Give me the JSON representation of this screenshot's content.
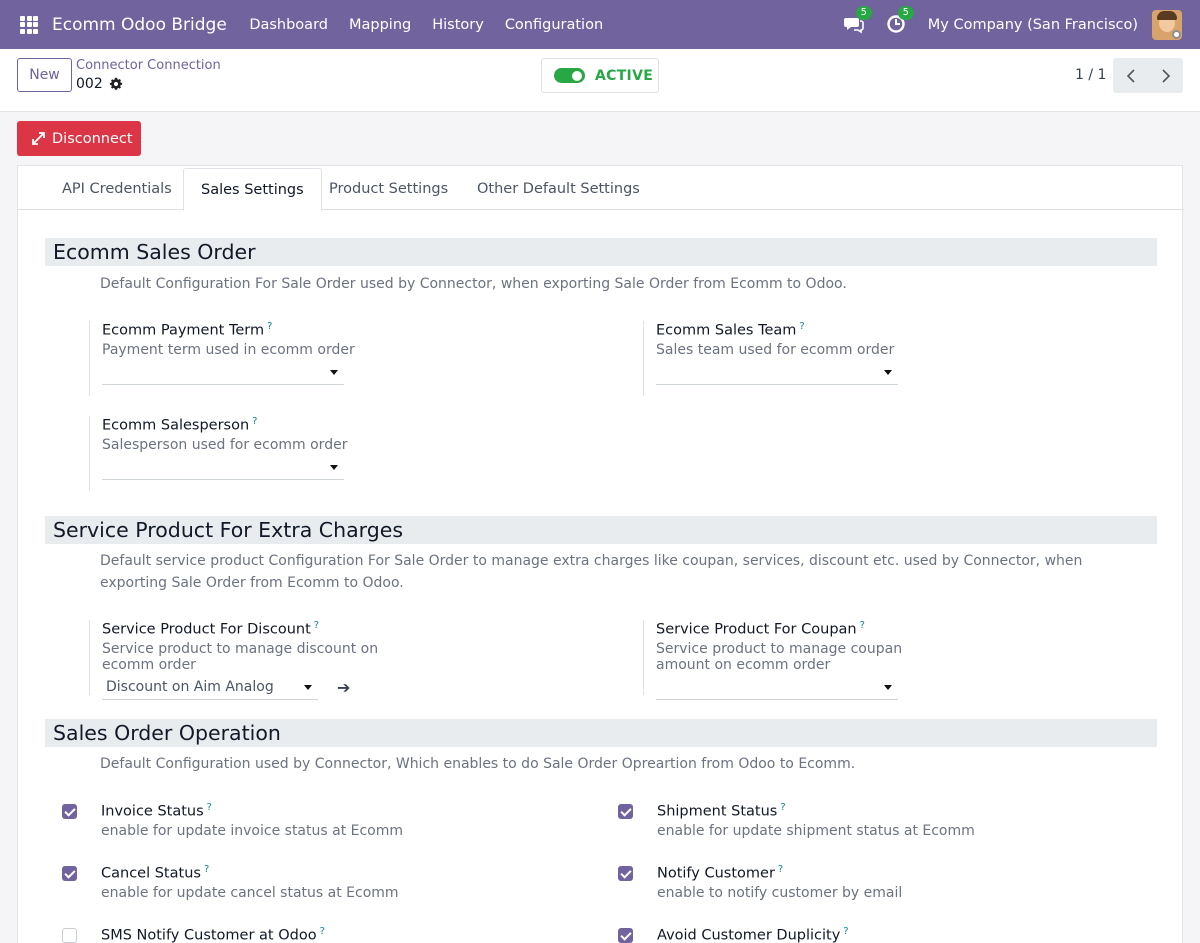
{
  "navbar": {
    "brand": "Ecomm Odoo Bridge",
    "menu": [
      "Dashboard",
      "Mapping",
      "History",
      "Configuration"
    ],
    "messages_badge": "5",
    "activities_badge": "5",
    "company": "My Company (San Francisco)"
  },
  "control": {
    "new_label": "New",
    "breadcrumb": "Connector Connection",
    "record_name": "002",
    "active_label": "ACTIVE",
    "pager": "1 / 1"
  },
  "actions": {
    "disconnect_label": "Disconnect"
  },
  "tabs": [
    "API Credentials",
    "Sales Settings",
    "Product Settings",
    "Other Default Settings"
  ],
  "active_tab": "Sales Settings",
  "sections": {
    "sales_order": {
      "title": "Ecomm Sales Order",
      "description": "Default Configuration For Sale Order used by Connector, when exporting Sale Order from Ecomm to Odoo.",
      "fields": {
        "payment_term": {
          "label": "Ecomm Payment Term",
          "help": "?",
          "description": "Payment term used in ecomm order",
          "value": ""
        },
        "sales_team": {
          "label": "Ecomm Sales Team",
          "help": "?",
          "description": "Sales team used for ecomm order",
          "value": ""
        },
        "salesperson": {
          "label": "Ecomm Salesperson",
          "help": "?",
          "description": "Salesperson used for ecomm order",
          "value": ""
        }
      }
    },
    "extra_charges": {
      "title": "Service Product For Extra Charges",
      "description": "Default service product Configuration For Sale Order to manage extra charges like coupan, services, discount etc. used by Connector, when exporting Sale Order from Ecomm to Odoo.",
      "fields": {
        "discount": {
          "label": "Service Product For Discount",
          "help": "?",
          "description": "Service product to manage discount on ecomm order",
          "value": "Discount on Aim Analog Watch"
        },
        "coupon": {
          "label": "Service Product For Coupan",
          "help": "?",
          "description": "Service product to manage coupan amount on ecomm order",
          "value": ""
        }
      }
    },
    "operation": {
      "title": "Sales Order Operation",
      "description": "Default Configuration used by Connector, Which enables to do Sale Order Opreartion from Odoo to Ecomm.",
      "checks": {
        "invoice_status": {
          "label": "Invoice Status",
          "help": "?",
          "description": "enable for update invoice status at Ecomm",
          "checked": true
        },
        "shipment_status": {
          "label": "Shipment Status",
          "help": "?",
          "description": "enable for update shipment status at Ecomm",
          "checked": true
        },
        "cancel_status": {
          "label": "Cancel Status",
          "help": "?",
          "description": "enable for update cancel status at Ecomm",
          "checked": true
        },
        "notify_customer": {
          "label": "Notify Customer",
          "help": "?",
          "description": "enable to notify customer by email",
          "checked": true
        },
        "sms_notify": {
          "label": "SMS Notify Customer at Odoo",
          "help": "?",
          "description": "",
          "checked": false
        },
        "avoid_duplicity": {
          "label": "Avoid Customer Duplicity",
          "help": "?",
          "description": "",
          "checked": true
        }
      }
    }
  },
  "colors": {
    "navbar": "#71639e",
    "primary": "#71639e",
    "active_green": "#28a745",
    "danger": "#dc3545",
    "help_teal": "#0e8b8b"
  }
}
